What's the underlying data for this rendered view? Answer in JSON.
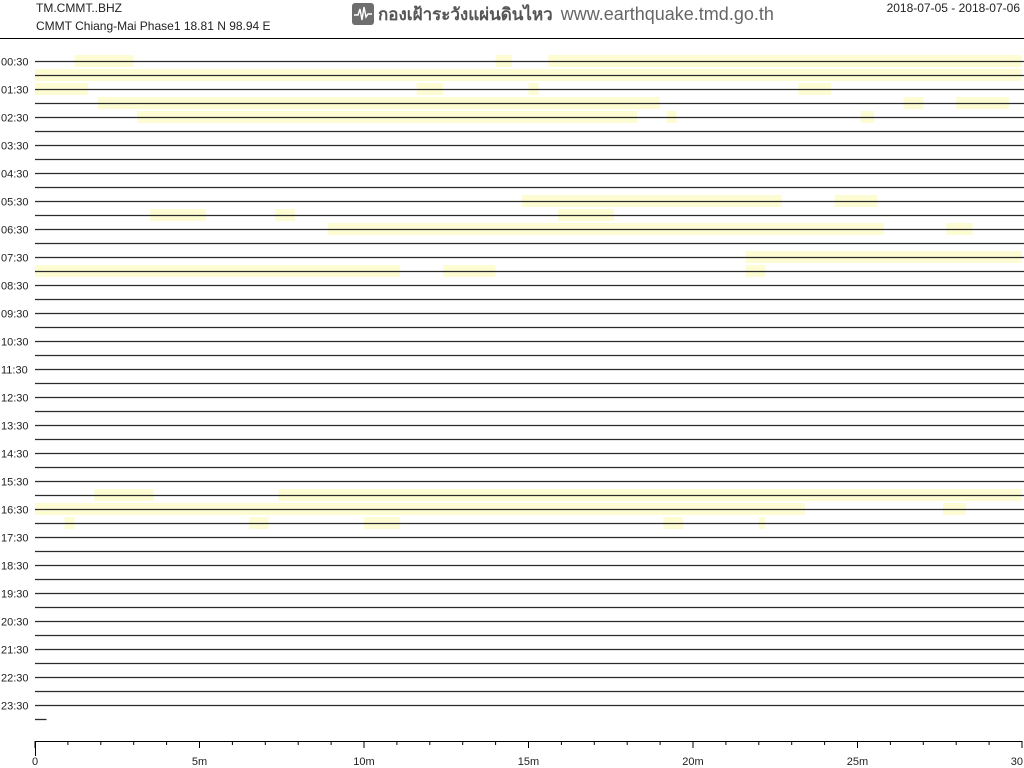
{
  "header": {
    "station_code": "TM.CMMT..BHZ",
    "station_desc": "CMMT Chiang-Mai Phase1  18.81 N 98.94 E",
    "date_range": "2018-07-05 - 2018-07-06",
    "logo_thai": "กองเฝ้าระวังแผ่นดินไหว",
    "logo_url": "www.earthquake.tmd.go.th",
    "logo_icon": "seismograph-icon"
  },
  "colors": {
    "trace": "#2b2b2b",
    "highlight": "#fdfcd2",
    "axis": "#000000",
    "text": "#222222"
  },
  "chart_data": {
    "type": "helicorder",
    "title": "",
    "xlabel": "",
    "ylabel": "",
    "xlim": [
      0,
      30
    ],
    "x_ticks": [
      {
        "value": 0,
        "label": "0"
      },
      {
        "value": 5,
        "label": "5m"
      },
      {
        "value": 10,
        "label": "10m"
      },
      {
        "value": 15,
        "label": "15m"
      },
      {
        "value": 20,
        "label": "20m"
      },
      {
        "value": 25,
        "label": "25m"
      },
      {
        "value": 30,
        "label": "30"
      }
    ],
    "hour_labels": [
      "00:30",
      "01:30",
      "02:30",
      "03:30",
      "04:30",
      "05:30",
      "06:30",
      "07:30",
      "08:30",
      "09:30",
      "10:30",
      "11:30",
      "12:30",
      "13:30",
      "14:30",
      "15:30",
      "16:30",
      "17:30",
      "18:30",
      "19:30",
      "20:30",
      "21:30",
      "22:30",
      "23:30"
    ],
    "trace_count": 48,
    "last_trace_end_minute": 0.35,
    "highlights": [
      {
        "trace": 0,
        "x0": 1.2,
        "x1": 3.0
      },
      {
        "trace": 0,
        "x0": 14.0,
        "x1": 14.5
      },
      {
        "trace": 0,
        "x0": 15.6,
        "x1": 30
      },
      {
        "trace": 1,
        "x0": 0,
        "x1": 30
      },
      {
        "trace": 2,
        "x0": 0,
        "x1": 1.6
      },
      {
        "trace": 2,
        "x0": 11.6,
        "x1": 12.4
      },
      {
        "trace": 2,
        "x0": 15.0,
        "x1": 15.3
      },
      {
        "trace": 2,
        "x0": 23.2,
        "x1": 24.2
      },
      {
        "trace": 3,
        "x0": 1.9,
        "x1": 19.0
      },
      {
        "trace": 3,
        "x0": 26.4,
        "x1": 27.0
      },
      {
        "trace": 3,
        "x0": 28.0,
        "x1": 29.6
      },
      {
        "trace": 4,
        "x0": 3.1,
        "x1": 18.3
      },
      {
        "trace": 4,
        "x0": 19.2,
        "x1": 19.5
      },
      {
        "trace": 4,
        "x0": 25.1,
        "x1": 25.5
      },
      {
        "trace": 10,
        "x0": 14.8,
        "x1": 22.7
      },
      {
        "trace": 10,
        "x0": 24.3,
        "x1": 25.6
      },
      {
        "trace": 11,
        "x0": 3.5,
        "x1": 5.2
      },
      {
        "trace": 11,
        "x0": 7.3,
        "x1": 7.9
      },
      {
        "trace": 11,
        "x0": 15.9,
        "x1": 17.6
      },
      {
        "trace": 12,
        "x0": 8.9,
        "x1": 25.8
      },
      {
        "trace": 12,
        "x0": 27.7,
        "x1": 28.5
      },
      {
        "trace": 14,
        "x0": 21.6,
        "x1": 30
      },
      {
        "trace": 15,
        "x0": 0,
        "x1": 11.1
      },
      {
        "trace": 15,
        "x0": 12.4,
        "x1": 14.0
      },
      {
        "trace": 15,
        "x0": 21.6,
        "x1": 22.2
      },
      {
        "trace": 31,
        "x0": 1.8,
        "x1": 3.6
      },
      {
        "trace": 31,
        "x0": 7.4,
        "x1": 30
      },
      {
        "trace": 32,
        "x0": 0,
        "x1": 23.4
      },
      {
        "trace": 32,
        "x0": 27.6,
        "x1": 28.3
      },
      {
        "trace": 33,
        "x0": 0.9,
        "x1": 1.2
      },
      {
        "trace": 33,
        "x0": 6.5,
        "x1": 7.1
      },
      {
        "trace": 33,
        "x0": 10.0,
        "x1": 11.1
      },
      {
        "trace": 33,
        "x0": 19.1,
        "x1": 19.7
      },
      {
        "trace": 33,
        "x0": 22.0,
        "x1": 22.2
      }
    ]
  }
}
